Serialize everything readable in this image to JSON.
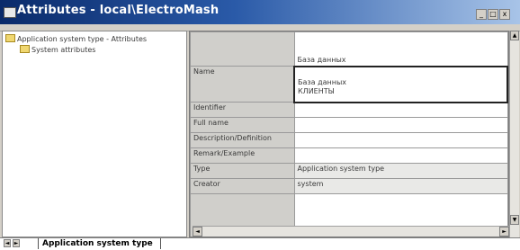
{
  "window": {
    "title": "Attributes - local\\ElectroMash",
    "minimize": "_",
    "maximize": "□",
    "close": "x"
  },
  "tree": {
    "items": [
      {
        "label": "Application system type - Attributes",
        "level": 0
      },
      {
        "label": "System attributes",
        "level": 1
      }
    ]
  },
  "grid": {
    "header_value": "База данных",
    "rows": [
      {
        "label": "Name",
        "value_lines": [
          "База данных",
          "КЛИЕНТЫ"
        ]
      },
      {
        "label": "Identifier",
        "value": ""
      },
      {
        "label": "Full name",
        "value": ""
      },
      {
        "label": "Description/Definition",
        "value": ""
      },
      {
        "label": "Remark/Example",
        "value": ""
      },
      {
        "label": "Type",
        "value": "Application system type"
      },
      {
        "label": "Creator",
        "value": "system"
      }
    ]
  },
  "sheet_tabs": [
    {
      "label": "Application system type",
      "active": true
    }
  ],
  "nav": {
    "first": "◄",
    "next": "►"
  }
}
